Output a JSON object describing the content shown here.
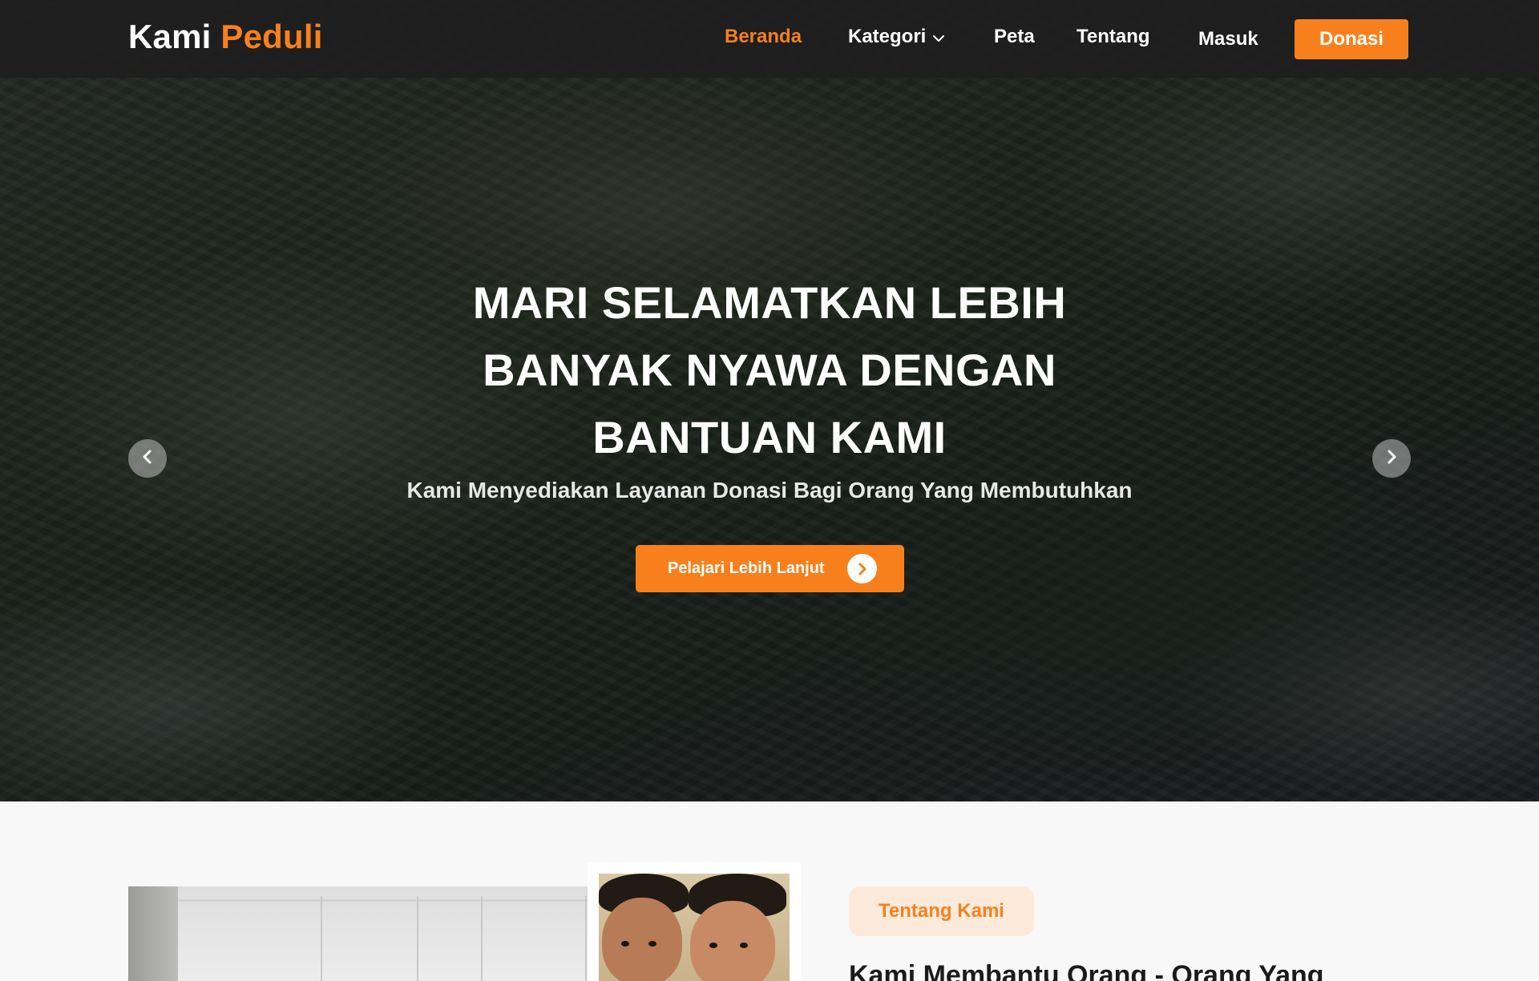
{
  "brand": {
    "name": "Kami",
    "accent": "Peduli"
  },
  "nav": {
    "items": [
      {
        "label": "Beranda",
        "active": true
      },
      {
        "label": "Kategori",
        "dropdown": true
      },
      {
        "label": "Peta"
      },
      {
        "label": "Tentang"
      },
      {
        "label": "Masuk"
      }
    ],
    "donate_label": "Donasi"
  },
  "hero": {
    "title_lines": [
      "MARI SELAMATKAN LEBIH",
      "BANYAK NYAWA DENGAN",
      "BANTUAN KAMI"
    ],
    "subtitle": "Kami Menyediakan Layanan Donasi Bagi Orang Yang Membutuhkan",
    "cta_label": "Pelajari Lebih Lanjut",
    "cta_icon": "chevron-right-icon",
    "prev_icon": "chevron-left-icon",
    "next_icon": "chevron-right-icon"
  },
  "about": {
    "badge": "Tentang Kami",
    "heading": "Kami Membantu Orang - Orang Yang"
  },
  "colors": {
    "accent": "#f7801d",
    "navbar": "#1e1e1e",
    "badge_bg": "#fdeadb",
    "page_bg": "#f8f8f8"
  }
}
